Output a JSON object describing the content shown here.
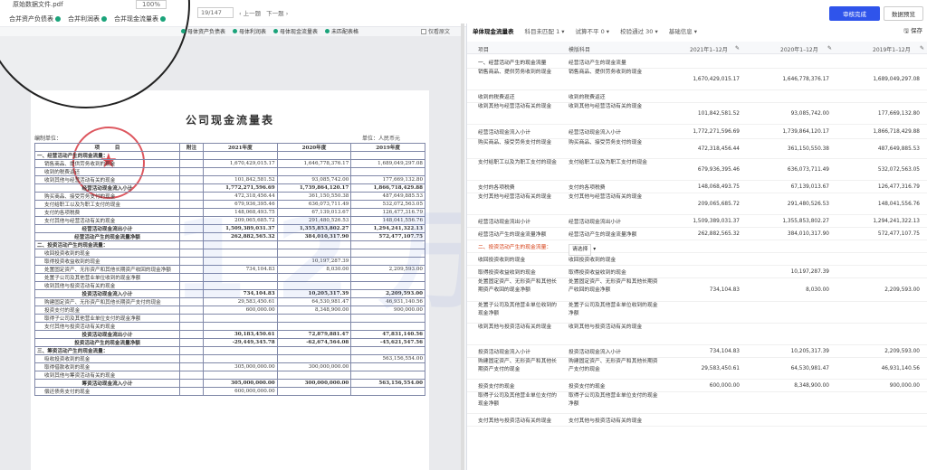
{
  "magnifier": {
    "title": "原始数据文件.pdf",
    "zoom": "100%"
  },
  "left_tabs_main": [
    {
      "label": "合并资产负债表"
    },
    {
      "label": "合并利润表"
    },
    {
      "label": "合并现金流量表"
    }
  ],
  "left_tabs_sub": [
    {
      "label": "母体资产负债表"
    },
    {
      "label": "母体利润表"
    },
    {
      "label": "母体现金流量表"
    },
    {
      "label": "未匹配表格"
    }
  ],
  "pager": {
    "page": "19",
    "total": "/147",
    "prev": "上一题",
    "next": "下一题"
  },
  "original_toggle": "仅看原文",
  "actions": {
    "primary": "审核完成",
    "secondary": "数据预览"
  },
  "doc": {
    "title": "公司现金流量表",
    "org": "编制单位：",
    "unit": "单位：人民币元",
    "headers": [
      "项　　　目",
      "附注",
      "2021年度",
      "2020年度",
      "2019年度"
    ],
    "rows": [
      {
        "label": "一、经营活动产生的现金流量：",
        "v1": "",
        "v2": "",
        "v3": "",
        "bold": true
      },
      {
        "label": "销售商品、提供劳务收到的现金",
        "v1": "1,670,429,015.17",
        "v2": "1,646,778,376.17",
        "v3": "1,689,049,297.08"
      },
      {
        "label": "收到的税费返还",
        "v1": "",
        "v2": "",
        "v3": ""
      },
      {
        "label": "收到其他与经营活动有关的现金",
        "v1": "101,842,581.52",
        "v2": "93,085,742.00",
        "v3": "177,669,132.80"
      },
      {
        "label": "经营活动现金流入小计",
        "v1": "1,772,271,596.69",
        "v2": "1,739,864,120.17",
        "v3": "1,866,718,429.88",
        "bold": true,
        "center": true
      },
      {
        "label": "购买商品、接受劳务支付的现金",
        "v1": "472,318,456.44",
        "v2": "361,150,550.38",
        "v3": "487,649,885.53"
      },
      {
        "label": "支付给职工以及为职工支付的现金",
        "v1": "679,936,395.46",
        "v2": "636,073,711.49",
        "v3": "532,072,563.05"
      },
      {
        "label": "支付的各项税费",
        "v1": "148,068,493.75",
        "v2": "67,139,013.67",
        "v3": "126,477,316.79"
      },
      {
        "label": "支付其他与经营活动有关的现金",
        "v1": "209,065,685.72",
        "v2": "291,480,526.53",
        "v3": "148,041,556.76"
      },
      {
        "label": "经营活动现金流出小计",
        "v1": "1,509,389,031.37",
        "v2": "1,355,853,802.27",
        "v3": "1,294,241,322.13",
        "bold": true,
        "center": true
      },
      {
        "label": "经营活动产生的现金流量净额",
        "v1": "262,882,565.32",
        "v2": "384,010,317.90",
        "v3": "572,477,107.75",
        "bold": true,
        "center": true
      },
      {
        "label": "二、投资活动产生的现金流量：",
        "v1": "",
        "v2": "",
        "v3": "",
        "bold": true
      },
      {
        "label": "收回投资收到的现金",
        "v1": "",
        "v2": "",
        "v3": ""
      },
      {
        "label": "取得投资收益收到的现金",
        "v1": "",
        "v2": "10,197,287.39",
        "v3": ""
      },
      {
        "label": "处置固定资产、无形资产和其他长期资产收回的现金净额",
        "v1": "734,104.83",
        "v2": "8,030.00",
        "v3": "2,209,593.00"
      },
      {
        "label": "处置子公司及其他营业单位收到的现金净额",
        "v1": "",
        "v2": "",
        "v3": ""
      },
      {
        "label": "收到其他与投资活动有关的现金",
        "v1": "",
        "v2": "",
        "v3": ""
      },
      {
        "label": "投资活动现金流入小计",
        "v1": "734,104.83",
        "v2": "10,205,317.39",
        "v3": "2,209,593.00",
        "bold": true,
        "center": true
      },
      {
        "label": "购建固定资产、无形资产和其他长期资产支付的现金",
        "v1": "29,583,450.61",
        "v2": "64,530,981.47",
        "v3": "46,931,140.56"
      },
      {
        "label": "投资支付的现金",
        "v1": "600,000.00",
        "v2": "8,348,900.00",
        "v3": "900,000.00"
      },
      {
        "label": "取得子公司及其他营业单位支付的现金净额",
        "v1": "",
        "v2": "",
        "v3": ""
      },
      {
        "label": "支付其他与投资活动有关的现金",
        "v1": "",
        "v2": "",
        "v3": ""
      },
      {
        "label": "投资活动现金流出小计",
        "v1": "30,183,450.61",
        "v2": "72,879,881.47",
        "v3": "47,831,140.56",
        "bold": true,
        "center": true
      },
      {
        "label": "投资活动产生的现金流量净额",
        "v1": "-29,449,345.78",
        "v2": "-62,674,564.08",
        "v3": "-45,621,547.56",
        "bold": true,
        "center": true
      },
      {
        "label": "三、筹资活动产生的现金流量：",
        "v1": "",
        "v2": "",
        "v3": "",
        "bold": true
      },
      {
        "label": "吸收投资收到的现金",
        "v1": "",
        "v2": "",
        "v3": "563,156,554.00"
      },
      {
        "label": "取得借款收到的现金",
        "v1": "305,000,000.00",
        "v2": "300,000,000.00",
        "v3": ""
      },
      {
        "label": "收到其他与筹资活动有关的现金",
        "v1": "",
        "v2": "",
        "v3": ""
      },
      {
        "label": "筹资活动现金流入小计",
        "v1": "305,000,000.00",
        "v2": "300,000,000.00",
        "v3": "563,156,554.00",
        "bold": true,
        "center": true
      },
      {
        "label": "偿还债务支付的现金",
        "v1": "600,000,000.00",
        "v2": "",
        "v3": ""
      }
    ]
  },
  "right": {
    "tabs": [
      {
        "label": "单体现金流量表",
        "active": true
      },
      {
        "label": "科目未匹配 1 ▾"
      },
      {
        "label": "试算不平 0 ▾"
      },
      {
        "label": "校验通过 30 ▾"
      },
      {
        "label": "基础信息 ▾"
      }
    ],
    "save": "保存",
    "headers": [
      "项目",
      "模版科目",
      "2021年1–12月",
      "2020年1–12月",
      "2019年1–12月"
    ],
    "rows": [
      {
        "c1": "一、经营活动产生的现金流量",
        "c2": "经营活动产生的现金流量",
        "c3": "",
        "c4": "",
        "c5": "",
        "h": 14,
        "type": "sec"
      },
      {
        "c1": "销售商品、提供劳务收到的现金",
        "c2": "销售商品、提供劳务收到的现金",
        "c3": "1,670,429,015.17",
        "c4": "1,646,778,376.17",
        "c5": "1,689,049,297.08",
        "h": 24
      },
      {
        "c1": "收到的税费返还",
        "c2": "收到的税费返还",
        "c3": "",
        "c4": "",
        "c5": "",
        "h": 14
      },
      {
        "c1": "收到其他与经营活动有关的现金",
        "c2": "收到其他与经营活动有关的现金",
        "c3": "101,842,581.52",
        "c4": "93,085,742.00",
        "c5": "177,669,132.80",
        "h": 24
      },
      {
        "c1": "经营活动现金流入小计",
        "c2": "经营活动现金流入小计",
        "c3": "1,772,271,596.69",
        "c4": "1,739,864,120.17",
        "c5": "1,866,718,429.88",
        "h": 16
      },
      {
        "c1": "购买商品、接受劳务支付的现金",
        "c2": "购买商品、接受劳务支付的现金",
        "c3": "472,318,456.44",
        "c4": "361,150,550.38",
        "c5": "487,649,885.53",
        "h": 22
      },
      {
        "c1": "支付给职工以及为职工支付的现金",
        "c2": "支付给职工以及为职工支付的现金",
        "c3": "679,936,395.46",
        "c4": "636,073,711.49",
        "c5": "532,072,563.05",
        "h": 24
      },
      {
        "c1": "支付的各项税费",
        "c2": "支付的各项税费",
        "c3": "148,068,493.75",
        "c4": "67,139,013.67",
        "c5": "126,477,316.79",
        "h": 14
      },
      {
        "c1": "支付其他与经营活动有关的现金",
        "c2": "支付其他与经营活动有关的现金",
        "c3": "209,065,685.72",
        "c4": "291,480,526.53",
        "c5": "148,041,556.76",
        "h": 24
      },
      {
        "c1": "经营活动现金流出小计",
        "c2": "经营活动现金流出小计",
        "c3": "1,509,389,031.37",
        "c4": "1,355,853,802.27",
        "c5": "1,294,241,322.13",
        "h": 14
      },
      {
        "c1": "经营活动产生的现金流量净额",
        "c2": "经营活动产生的现金流量净额",
        "c3": "262,882,565.32",
        "c4": "384,010,317.90",
        "c5": "572,477,107.75",
        "h": 14
      },
      {
        "c1": "二、投资活动产生的现金流量：",
        "c2": "请选择",
        "c3": "",
        "c4": "",
        "c5": "",
        "h": 14,
        "type": "red",
        "select": true
      },
      {
        "c1": "收回投资收到的现金",
        "c2": "收回投资收到的现金",
        "c3": "",
        "c4": "",
        "c5": "",
        "h": 14
      },
      {
        "c1": "取得投资收益收到的现金",
        "c2": "取得投资收益收到的现金",
        "c3": "",
        "c4": "10,197,287.39",
        "c5": "",
        "h": 14
      },
      {
        "c1": "处置固定资产、无形资产和其他长期资产收回的现金净额",
        "c2": "处置固定资产、无形资产和其他长期资产收回的现金净额",
        "c3": "734,104.83",
        "c4": "8,030.00",
        "c5": "2,209,593.00",
        "h": 26
      },
      {
        "c1": "处置子公司及其他营业单位收到的现金净额",
        "c2": "处置子公司及其他营业单位收到的现金净额",
        "c3": "",
        "c4": "",
        "c5": "",
        "h": 24
      },
      {
        "c1": "收到其他与投资活动有关的现金",
        "c2": "收到其他与投资活动有关的现金",
        "c3": "",
        "c4": "",
        "c5": "",
        "h": 24
      },
      {
        "c1": "投资活动现金流入小计",
        "c2": "投资活动现金流入小计",
        "c3": "734,104.83",
        "c4": "10,205,317.39",
        "c5": "2,209,593.00",
        "h": 14
      },
      {
        "c1": "购建固定资产、无形资产和其他长期资产支付的现金",
        "c2": "购建固定资产、无形资产和其他长期资产支付的现金",
        "c3": "29,583,450.61",
        "c4": "64,530,981.47",
        "c5": "46,931,140.56",
        "h": 24
      },
      {
        "c1": "投资支付的现金",
        "c2": "投资支付的现金",
        "c3": "600,000.00",
        "c4": "8,348,900.00",
        "c5": "900,000.00",
        "h": 14
      },
      {
        "c1": "取得子公司及其他营业单位支付的现金净额",
        "c2": "取得子公司及其他营业单位支付的现金净额",
        "c3": "",
        "c4": "",
        "c5": "",
        "h": 24
      },
      {
        "c1": "支付其他与投资活动有关的现金",
        "c2": "支付其他与投资活动有关的现金",
        "c3": "",
        "c4": "",
        "c5": "",
        "h": 14
      }
    ]
  },
  "watermark": "12万数据",
  "colors": {
    "primary": "#2f54eb",
    "matched_dot": "#1aa37a",
    "unmatched_text": "#d4380d"
  }
}
